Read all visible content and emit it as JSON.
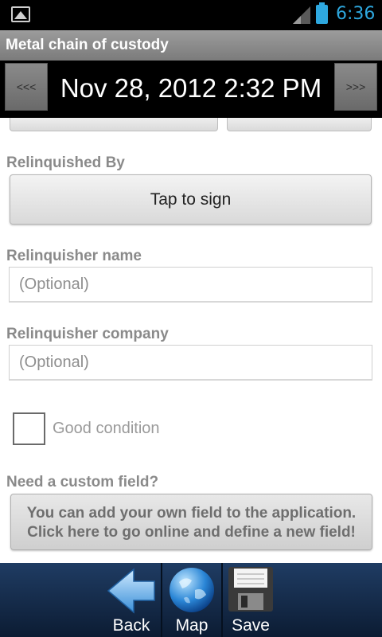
{
  "status": {
    "time": "6:36"
  },
  "app": {
    "title": "Metal chain of custody"
  },
  "datebar": {
    "prev_label": "<<<",
    "next_label": ">>>",
    "datetime": "Nov 28, 2012 2:32 PM"
  },
  "relinquished_by": {
    "label": "Relinquished By",
    "button": "Tap to sign"
  },
  "relinquisher_name": {
    "label": "Relinquisher name",
    "value": "",
    "placeholder": "(Optional)"
  },
  "relinquisher_company": {
    "label": "Relinquisher company",
    "value": "",
    "placeholder": "(Optional)"
  },
  "good_condition": {
    "label": "Good condition",
    "checked": false
  },
  "custom_field": {
    "label": "Need a custom field?",
    "button_line1": "You can add your own field to the application.",
    "button_line2": "Click here to go online and define a new field!"
  },
  "toolbar": {
    "items": [
      {
        "label": "Back",
        "icon": "back-arrow-icon"
      },
      {
        "label": "Map",
        "icon": "globe-icon"
      },
      {
        "label": "Save",
        "icon": "floppy-disk-icon"
      }
    ]
  },
  "colors": {
    "accent": "#2ea8df",
    "toolbar_bg": "#1f3c63",
    "label_gray": "#8a8a8a"
  }
}
